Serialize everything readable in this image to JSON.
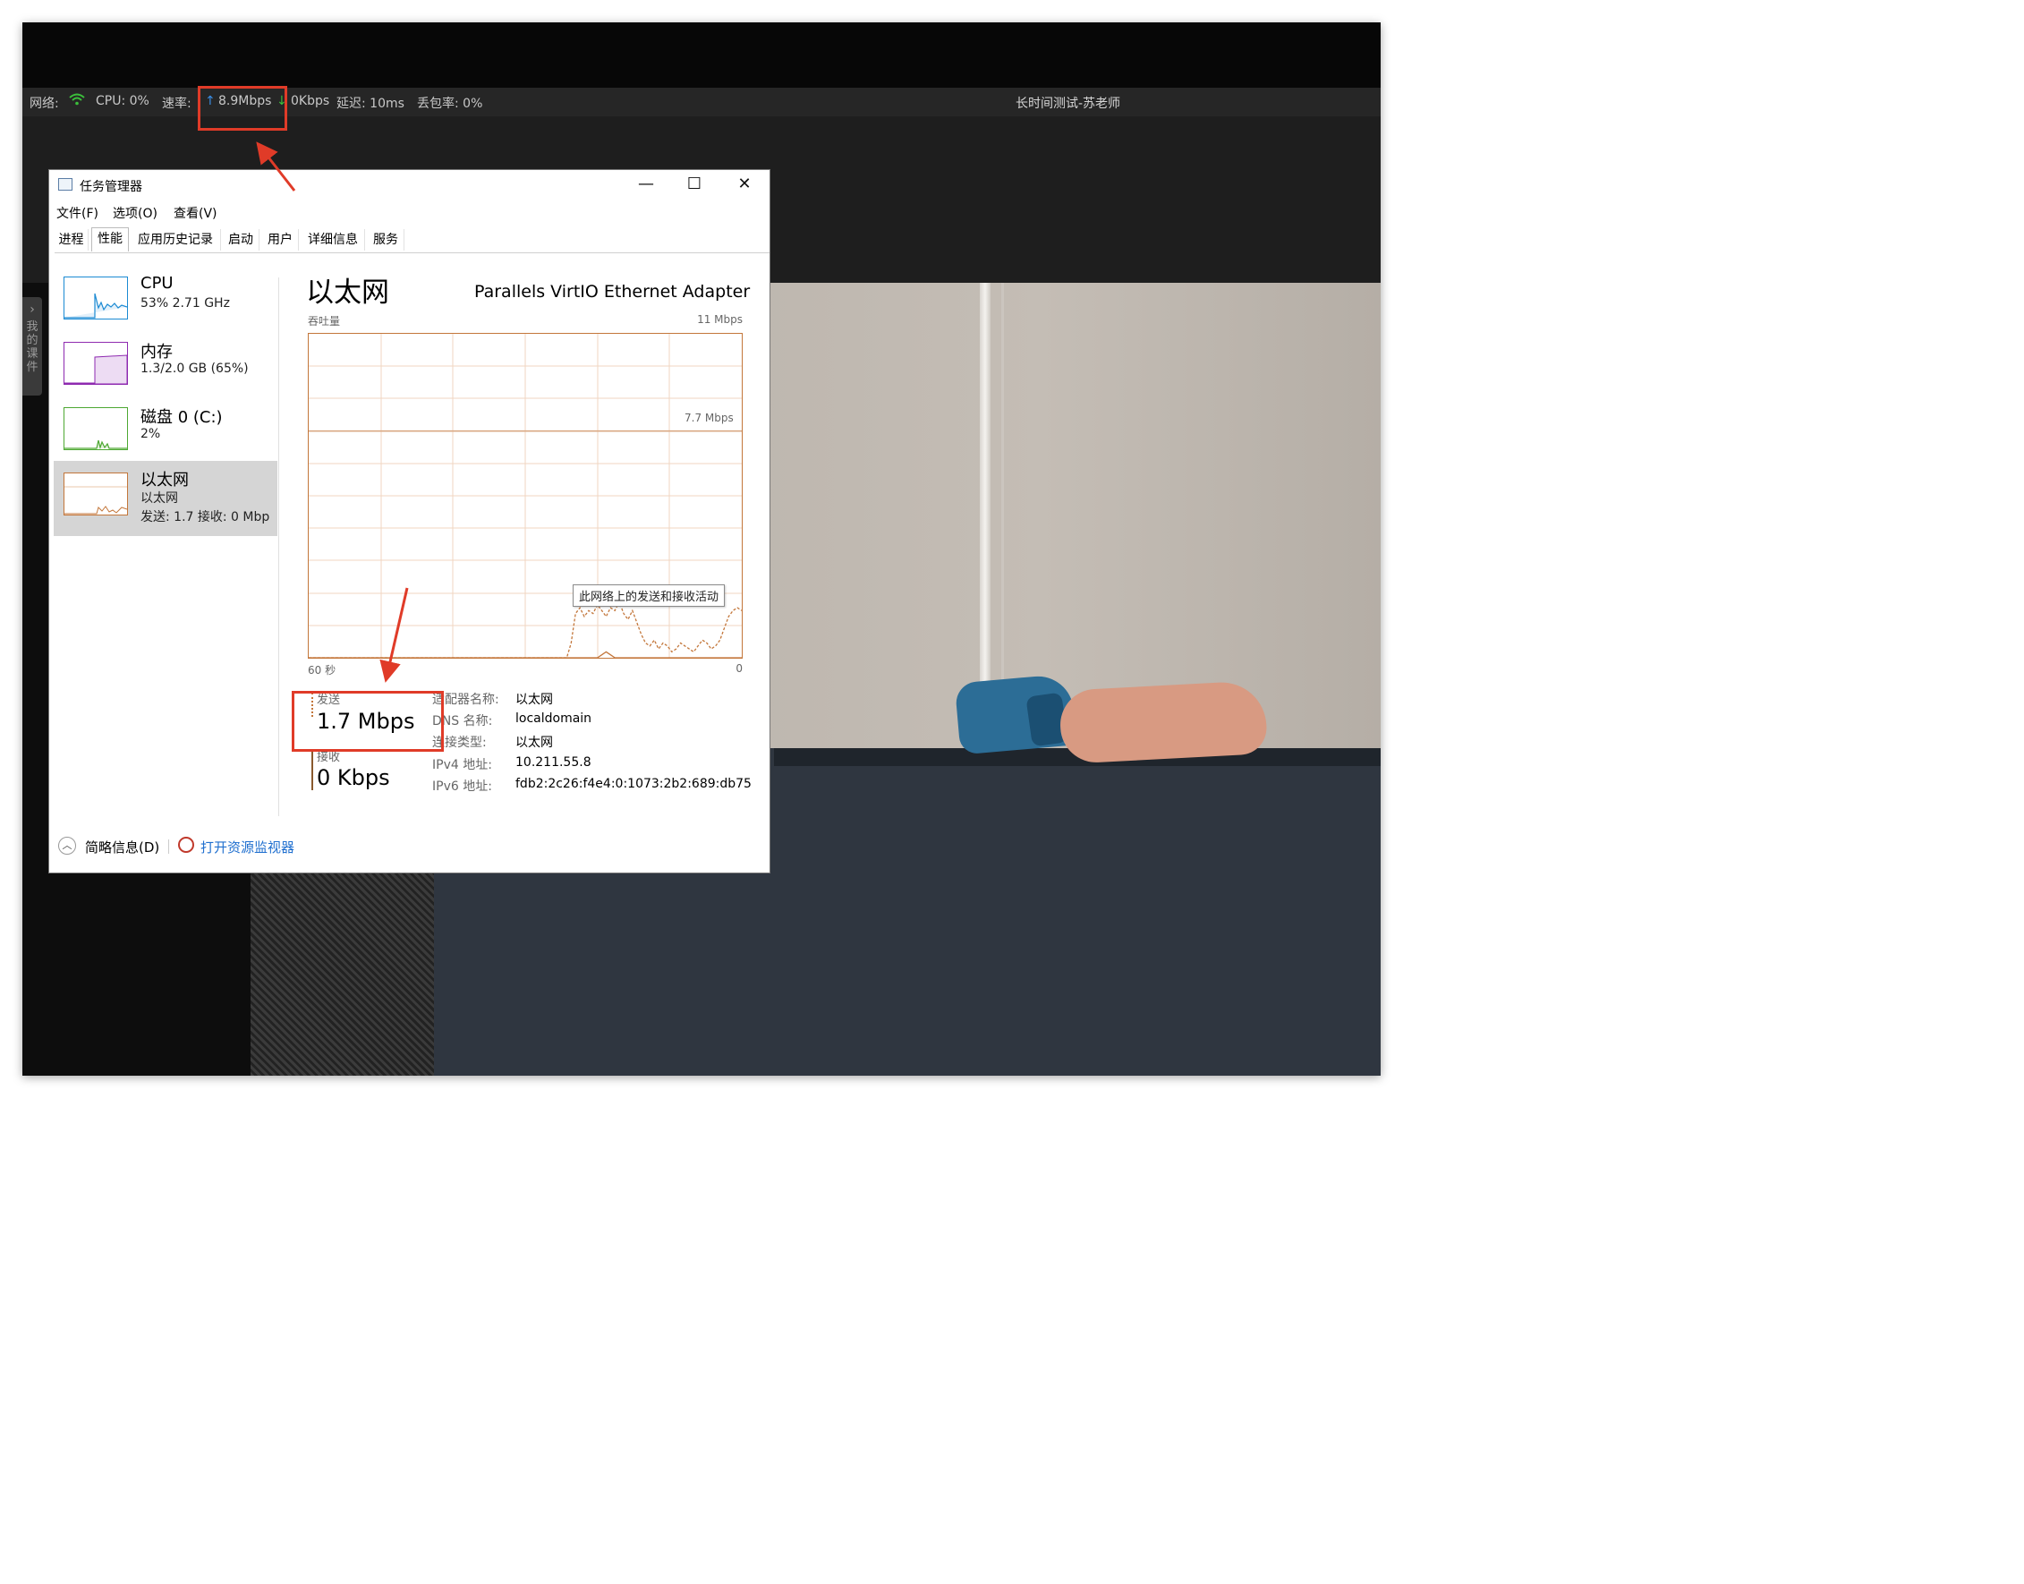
{
  "statusbar": {
    "network_label": "网络:",
    "cpu": "CPU: 0%",
    "speed_label": "速率:",
    "upload": "8.9Mbps",
    "download": "0Kbps",
    "latency": "延迟: 10ms",
    "loss": "丢包率: 0%",
    "room_title": "长时间测试-苏老师"
  },
  "sidetab": {
    "label": "我的课件"
  },
  "taskmgr": {
    "title": "任务管理器",
    "menu": [
      "文件(F)",
      "选项(O)",
      "查看(V)"
    ],
    "tabs": [
      "进程",
      "性能",
      "应用历史记录",
      "启动",
      "用户",
      "详细信息",
      "服务"
    ],
    "active_tab": "性能",
    "perf_items": [
      {
        "name": "CPU",
        "sub1": "53% 2.71 GHz",
        "sub2": ""
      },
      {
        "name": "内存",
        "sub1": "1.3/2.0 GB (65%)",
        "sub2": ""
      },
      {
        "name": "磁盘 0 (C:)",
        "sub1": "2%",
        "sub2": ""
      },
      {
        "name": "以太网",
        "sub1": "以太网",
        "sub2": "发送: 1.7 接收: 0 Mbp"
      }
    ],
    "selected_item": "以太网",
    "detail": {
      "title": "以太网",
      "adapter": "Parallels VirtIO Ethernet Adapter",
      "throughput_label": "吞吐量",
      "max_label": "11 Mbps",
      "mid_label": "7.7 Mbps",
      "time_left": "60 秒",
      "time_right": "0",
      "tooltip": "此网络上的发送和接收活动",
      "send_label": "发送",
      "send_value": "1.7 Mbps",
      "recv_label": "接收",
      "recv_value": "0 Kbps",
      "props": [
        {
          "k": "适配器名称:",
          "v": "以太网"
        },
        {
          "k": "DNS 名称:",
          "v": "localdomain"
        },
        {
          "k": "连接类型:",
          "v": "以太网"
        },
        {
          "k": "IPv4 地址:",
          "v": "10.211.55.8"
        },
        {
          "k": "IPv6 地址:",
          "v": "fdb2:2c26:f4e4:0:1073:2b2:689:db75"
        }
      ]
    },
    "footer": {
      "brief": "简略信息(D)",
      "resmon": "打开资源监视器"
    }
  },
  "graph_data": {
    "ymax_mbps": 11,
    "send_series_mbps": [
      0,
      0,
      0,
      0,
      0,
      0,
      0,
      0,
      0,
      0,
      0,
      0,
      0,
      0,
      0,
      0,
      0,
      0,
      0,
      0,
      0,
      0,
      0,
      0,
      0,
      0,
      0,
      0,
      0,
      0,
      0,
      0,
      0,
      0,
      0,
      0,
      0,
      0,
      0,
      0,
      0,
      0,
      0,
      0,
      0,
      0,
      0,
      0,
      0,
      0,
      0,
      0,
      0,
      0,
      0,
      0,
      0,
      0,
      0,
      0,
      0.5,
      1.5,
      1.7,
      1.4,
      1.6,
      1.5,
      1.8,
      1.6,
      1.4,
      1.7,
      1.6,
      1.9,
      1.5,
      1.3,
      1.6,
      1.2,
      0.8,
      0.5,
      0.4,
      0.6,
      0.3,
      0.5,
      0.4,
      0.2,
      0.3,
      0.5,
      0.4,
      0.3,
      0.2,
      0.4,
      0.6,
      0.5,
      0.3,
      0.4,
      0.6,
      1.0,
      1.4,
      1.6,
      1.7,
      1.6
    ],
    "recv_series_mbps": [
      0,
      0,
      0,
      0,
      0,
      0,
      0,
      0,
      0,
      0,
      0,
      0,
      0,
      0,
      0,
      0,
      0,
      0,
      0,
      0,
      0,
      0,
      0,
      0,
      0,
      0,
      0,
      0,
      0,
      0,
      0,
      0,
      0,
      0,
      0,
      0,
      0,
      0,
      0,
      0,
      0,
      0,
      0,
      0,
      0,
      0,
      0,
      0,
      0,
      0,
      0,
      0,
      0,
      0,
      0,
      0,
      0,
      0,
      0,
      0,
      0,
      0,
      0,
      0,
      0,
      0,
      0,
      0.1,
      0.2,
      0.1,
      0,
      0,
      0,
      0,
      0,
      0,
      0,
      0,
      0,
      0,
      0,
      0,
      0,
      0,
      0,
      0,
      0,
      0,
      0,
      0,
      0,
      0,
      0,
      0,
      0,
      0,
      0,
      0,
      0,
      0
    ]
  },
  "colors": {
    "net_accent": "#c3763a",
    "cpu_accent": "#1b8ad3",
    "mem_accent": "#8e2ab0",
    "disk_accent": "#4da832",
    "annotation": "#e03b28"
  }
}
